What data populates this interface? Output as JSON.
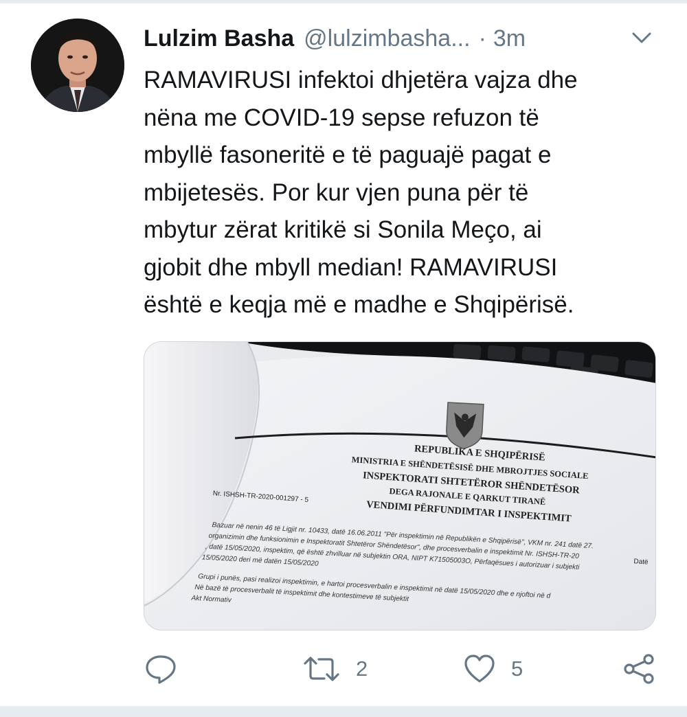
{
  "tweet": {
    "author_name": "Lulzim Basha",
    "author_handle": "@lulzimbasha...",
    "separator": "·",
    "timestamp": "3m",
    "text_lines": [
      "RAMAVIRUSI infektoi dhjetëra vajza dhe",
      "nëna me COVID-19 sepse refuzon të",
      "mbyllë fasoneritë e të paguajë pagat e",
      "mbijetesës. Por kur vjen puna për të",
      "mbytur zërat kritikë si Sonila Meço, ai",
      "gjobit dhe mbyll median! RAMAVIRUSI",
      "është e keqja më e madhe e Shqipërisë."
    ]
  },
  "media_document": {
    "heading_1": "REPUBLIKA E SHQIPËRISË",
    "heading_2": "MINISTRIA E SHËNDETËSISË DHE MBROJTJES SOCIALE",
    "heading_3": "INSPEKTORATI SHTETËROR SHËNDETËSOR",
    "heading_4": "DEGA RAJONALE E QARKUT TIRANË",
    "heading_5": "VENDIMI PËRFUNDIMTAR I INSPEKTIMIT",
    "doc_number": "Nr. ISHSH-TR-2020-001297 - 5",
    "date_label": "Datë",
    "body_1": "Bazuar në nenin 46 të Ligjit nr. 10433, datë 16.06.2011 \"Për inspektimin në Republikën e Shqipërisë\", VKM nr. 241 datë 27.",
    "body_2": "organizimin dhe funksionimin e Inspektoratit Shtetëror Shëndetësor\", dhe procesverbalin e inspektimit Nr. ISHSH-TR-20",
    "body_3": ", datë 15/05/2020, inspektim, që është zhvilluar në subjektin ORA, NIPT K71505003O, Përfaqësues i autorizuar i subjekti",
    "body_4": "15/05/2020 deri më datën 15/05/2020",
    "body_5": "Grupi i punës, pasi realizoi inspektimin, e hartoi procesverbalin e inspektimit në datë 15/05/2020 dhe e njoftoi në d",
    "body_6": "Në bazë të procesverbalit të inspektimit dhe kontestimeve të subjektit",
    "body_7": "Akt Normativ"
  },
  "actions": {
    "reply_icon": "reply-icon",
    "retweet_icon": "retweet-icon",
    "retweet_count": "2",
    "like_icon": "heart-icon",
    "like_count": "5",
    "share_icon": "share-icon"
  },
  "colors": {
    "text_primary": "#14171a",
    "text_secondary": "#657786",
    "divider": "#e6ecf0"
  }
}
